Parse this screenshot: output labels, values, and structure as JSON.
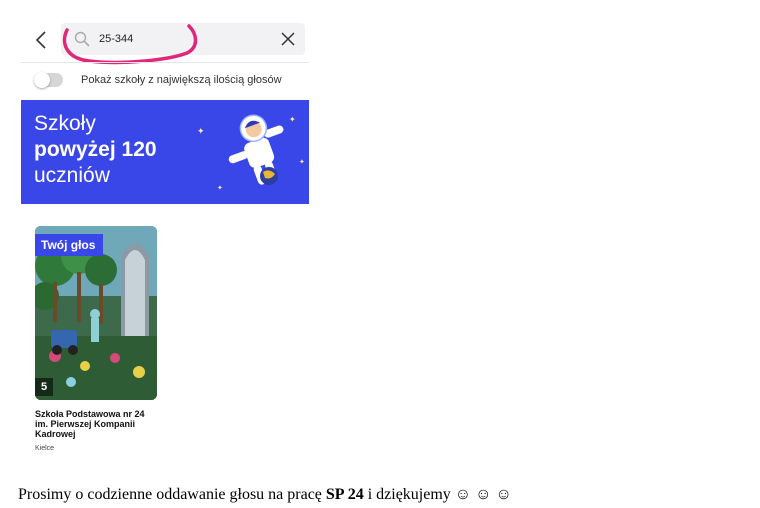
{
  "search": {
    "value": "25-344",
    "placeholder": ""
  },
  "filter": {
    "toggle_label": "Pokaż szkoły z największą ilością głosów",
    "enabled": false
  },
  "banner": {
    "line1": "Szkoły",
    "line2": "powyżej 120",
    "line3": "uczniów"
  },
  "card": {
    "badge": "Twój głos",
    "votes": "5",
    "title": "Szkoła Podstawowa nr 24 im. Pierwszej Kompanii Kadrowej",
    "city": "Kielce"
  },
  "footer": {
    "prefix": "Prosimy o codzienne oddawanie głosu na pracę ",
    "bold": "SP 24",
    "suffix": " i dziękujemy ☺ ☺ ☺"
  },
  "icons": {
    "back": "chevron-left-icon",
    "search": "search-icon",
    "clear": "close-icon"
  },
  "colors": {
    "accent": "#3a47e8",
    "annotation": "#e0287a"
  }
}
